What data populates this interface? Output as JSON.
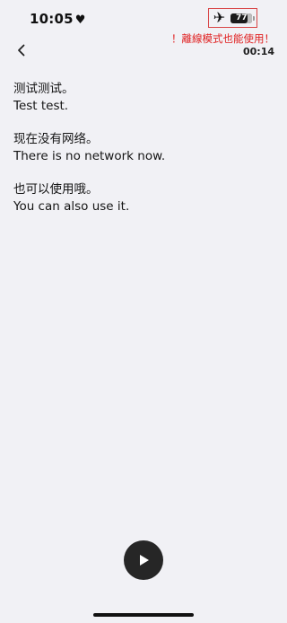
{
  "status_bar": {
    "time": "10:05",
    "heart_icon": "♥",
    "airplane_icon": "✈",
    "battery_level": "77",
    "battery_fraction": 0.77
  },
  "annotation_text": "！離線模式也能使用！",
  "timer": "00:14",
  "colors": {
    "background": "#f1f1f5",
    "annotation": "#e02020",
    "play_button": "#262626"
  },
  "transcript": [
    {
      "zh": "测试测试。",
      "en": "Test test."
    },
    {
      "zh": "现在没有网络。",
      "en": "There is no network now."
    },
    {
      "zh": "也可以使用哦。",
      "en": "You can also use it."
    }
  ]
}
